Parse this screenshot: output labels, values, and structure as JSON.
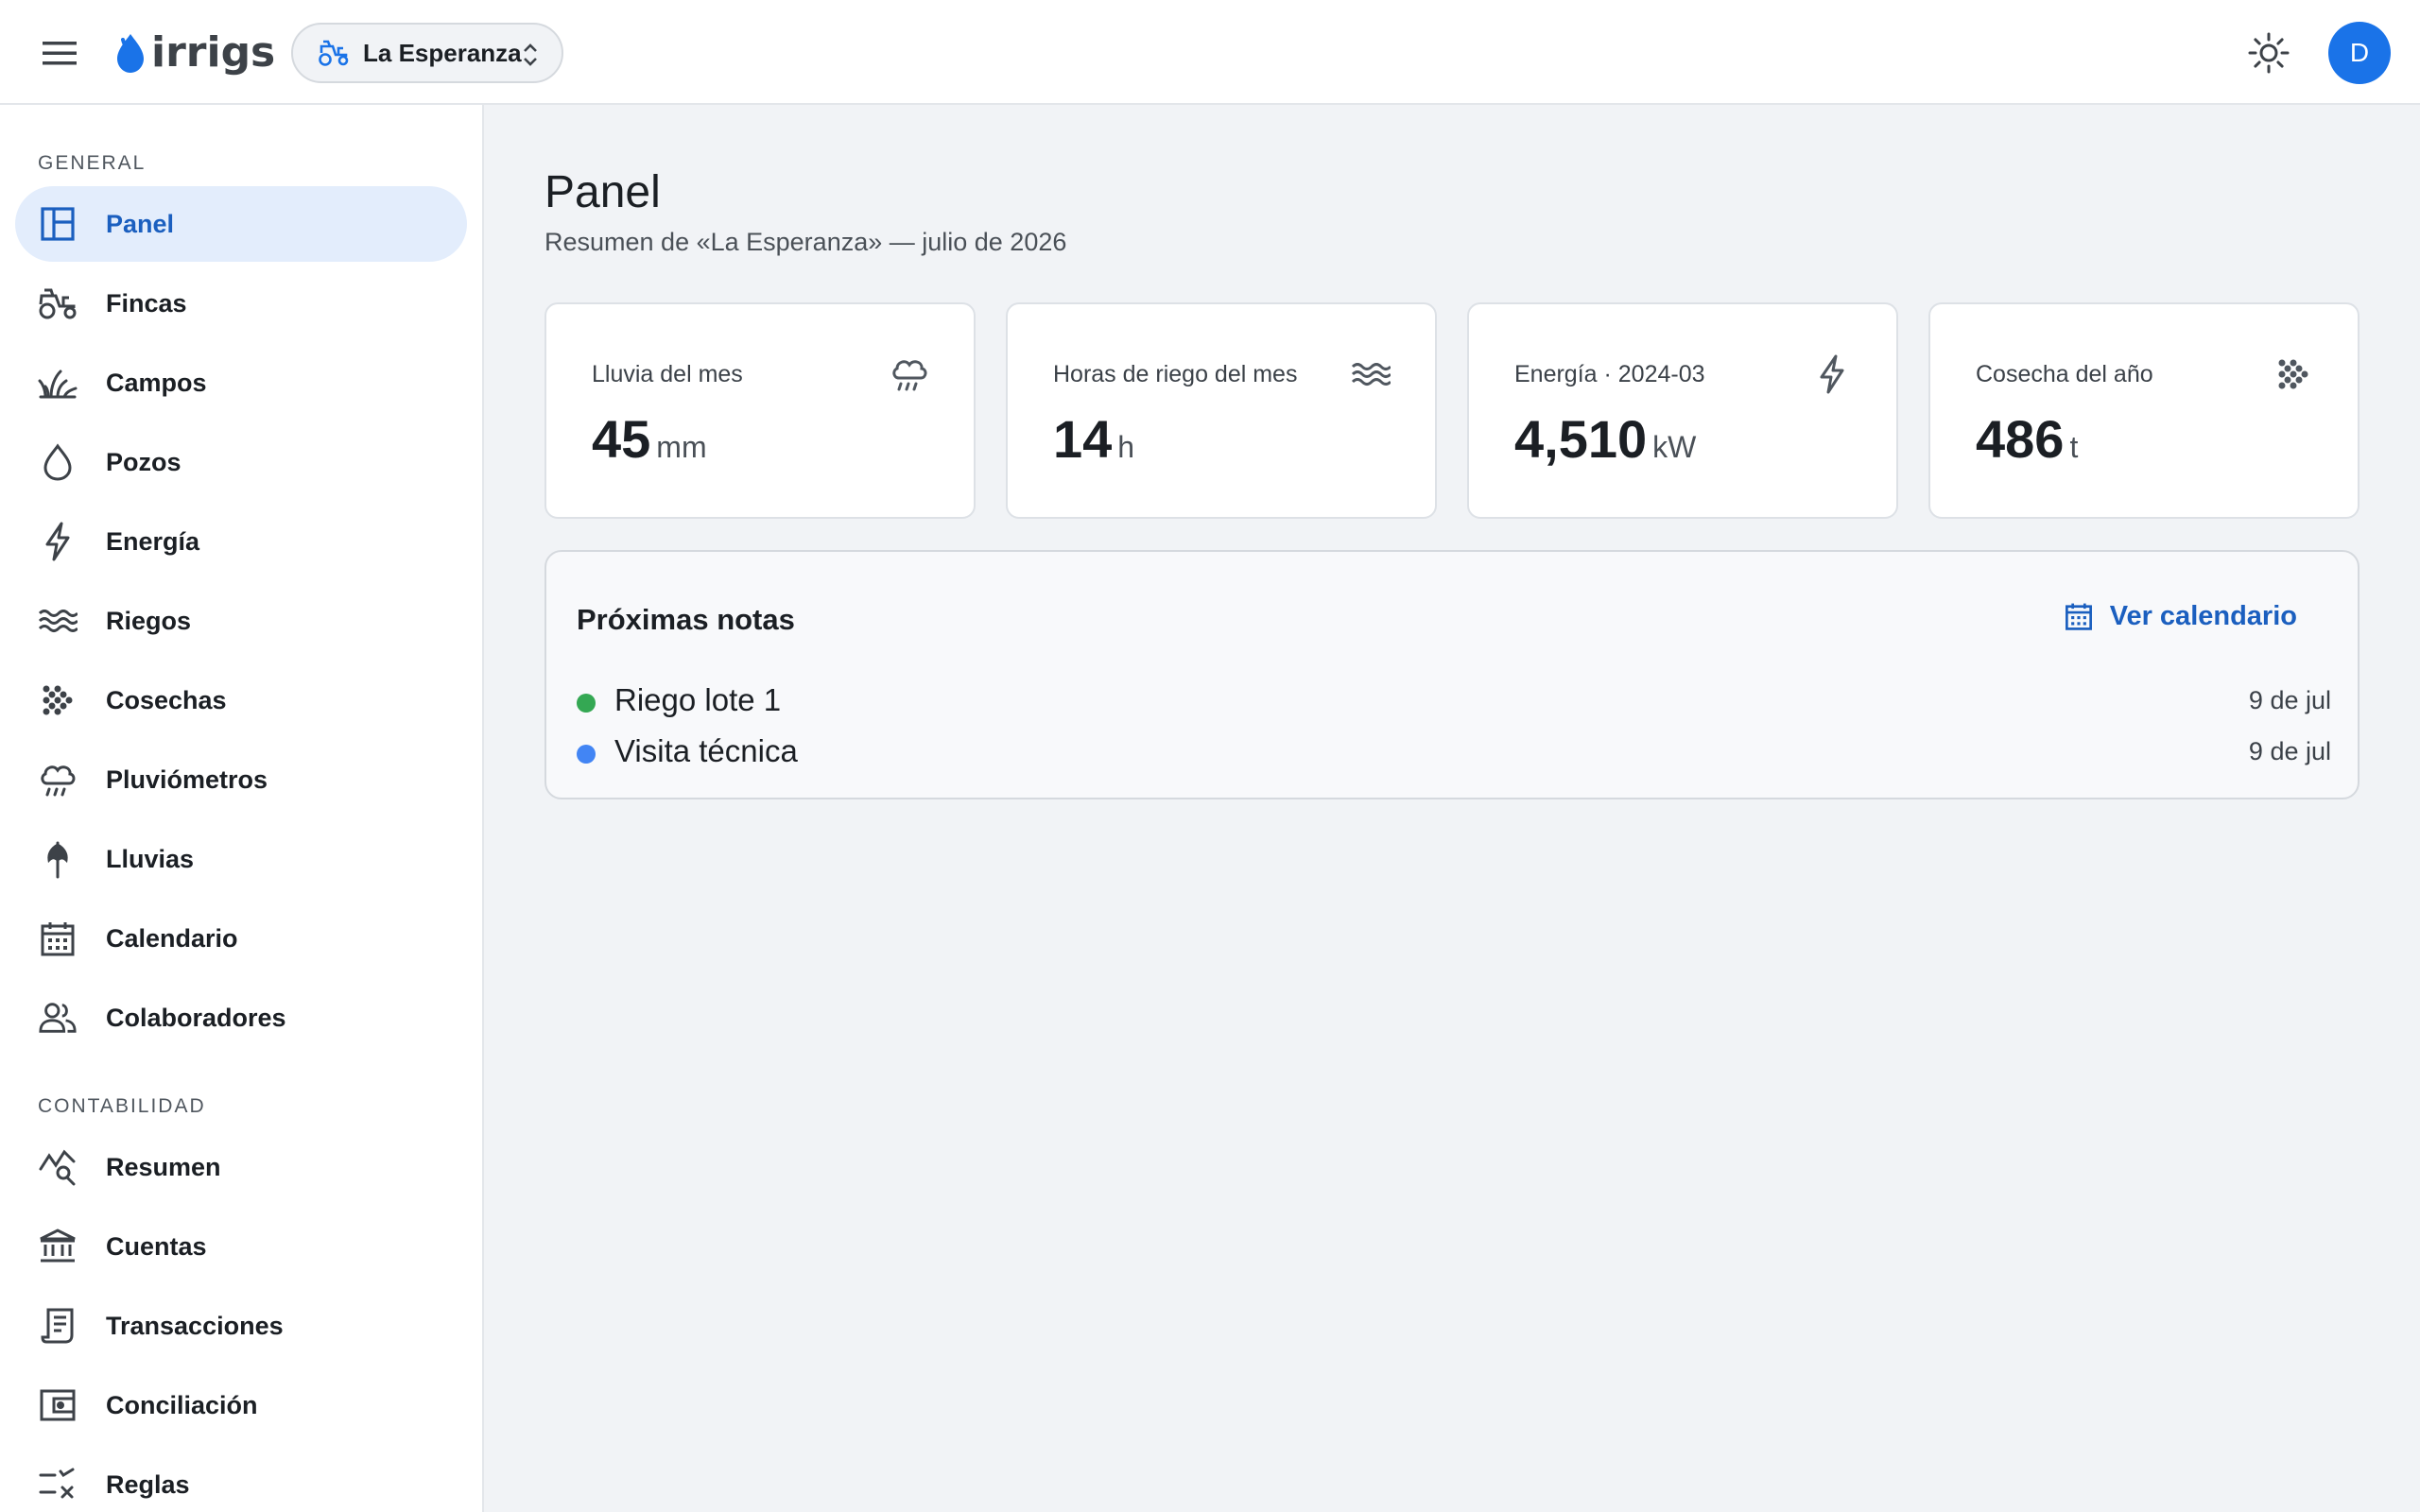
{
  "app": {
    "logo_text": "irrigs"
  },
  "header": {
    "farm_label": "La Esperanza",
    "avatar_initial": "D"
  },
  "sidebar": {
    "sections": [
      {
        "title": "GENERAL",
        "items": [
          {
            "label": "Panel",
            "icon": "dashboard-icon",
            "active": true
          },
          {
            "label": "Fincas",
            "icon": "tractor-icon"
          },
          {
            "label": "Campos",
            "icon": "grass-icon"
          },
          {
            "label": "Pozos",
            "icon": "water-drop-icon"
          },
          {
            "label": "Energía",
            "icon": "bolt-icon"
          },
          {
            "label": "Riegos",
            "icon": "waves-icon"
          },
          {
            "label": "Cosechas",
            "icon": "grain-icon"
          },
          {
            "label": "Pluviómetros",
            "icon": "rain-cloud-icon"
          },
          {
            "label": "Lluvias",
            "icon": "umbrella-icon"
          },
          {
            "label": "Calendario",
            "icon": "calendar-icon"
          },
          {
            "label": "Colaboradores",
            "icon": "people-icon"
          }
        ]
      },
      {
        "title": "CONTABILIDAD",
        "items": [
          {
            "label": "Resumen",
            "icon": "query-stats-icon"
          },
          {
            "label": "Cuentas",
            "icon": "bank-icon"
          },
          {
            "label": "Transacciones",
            "icon": "receipt-icon"
          },
          {
            "label": "Conciliación",
            "icon": "wallet-icon"
          },
          {
            "label": "Reglas",
            "icon": "rules-icon"
          }
        ]
      }
    ]
  },
  "main": {
    "title": "Panel",
    "subtitle": "Resumen de «La Esperanza» — julio de 2026",
    "stats": [
      {
        "label": "Lluvia del mes",
        "value": "45",
        "unit": "mm",
        "icon": "rain-cloud-icon"
      },
      {
        "label": "Horas de riego del mes",
        "value": "14",
        "unit": "h",
        "icon": "waves-icon"
      },
      {
        "label": "Energía · 2024-03",
        "value": "4,510",
        "unit": "kW",
        "icon": "bolt-icon"
      },
      {
        "label": "Cosecha del año",
        "value": "486",
        "unit": "t",
        "icon": "grain-icon"
      }
    ],
    "notes": {
      "title": "Próximas notas",
      "calendar_link": "Ver calendario",
      "items": [
        {
          "name": "Riego lote 1",
          "date": "9 de jul",
          "color": "#34a853"
        },
        {
          "name": "Visita técnica",
          "date": "9 de jul",
          "color": "#4285f4"
        }
      ]
    }
  },
  "colors": {
    "accent": "#1a73e8",
    "active_bg": "#e3edfc",
    "link": "#1b5fbf"
  }
}
